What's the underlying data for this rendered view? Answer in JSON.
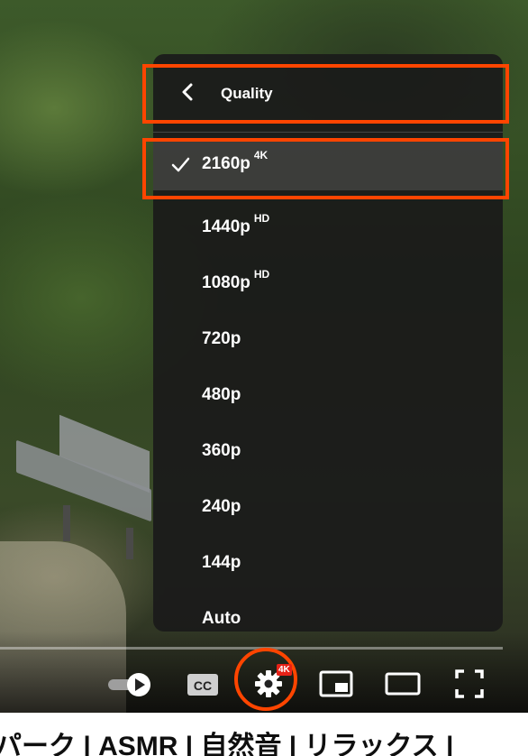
{
  "player": {
    "settings_menu": {
      "title": "Quality",
      "items": [
        {
          "label": "2160p",
          "badge": "4K",
          "selected": true
        },
        {
          "label": "1440p",
          "badge": "HD",
          "selected": false
        },
        {
          "label": "1080p",
          "badge": "HD",
          "selected": false
        },
        {
          "label": "720p",
          "badge": "",
          "selected": false
        },
        {
          "label": "480p",
          "badge": "",
          "selected": false
        },
        {
          "label": "360p",
          "badge": "",
          "selected": false
        },
        {
          "label": "240p",
          "badge": "",
          "selected": false
        },
        {
          "label": "144p",
          "badge": "",
          "selected": false
        },
        {
          "label": "Auto",
          "badge": "",
          "selected": false
        }
      ]
    },
    "controls": {
      "autoplay_icon": "autoplay-toggle-icon",
      "captions_label": "CC",
      "settings_icon": "gear-icon",
      "settings_badge": "4K",
      "miniplayer_icon": "miniplayer-icon",
      "theater_icon": "theater-mode-icon",
      "fullscreen_icon": "fullscreen-icon"
    },
    "highlight_color": "#ff4500"
  },
  "video": {
    "title_visible": "パーク | ASMR | 自然音 | リラックス |"
  }
}
